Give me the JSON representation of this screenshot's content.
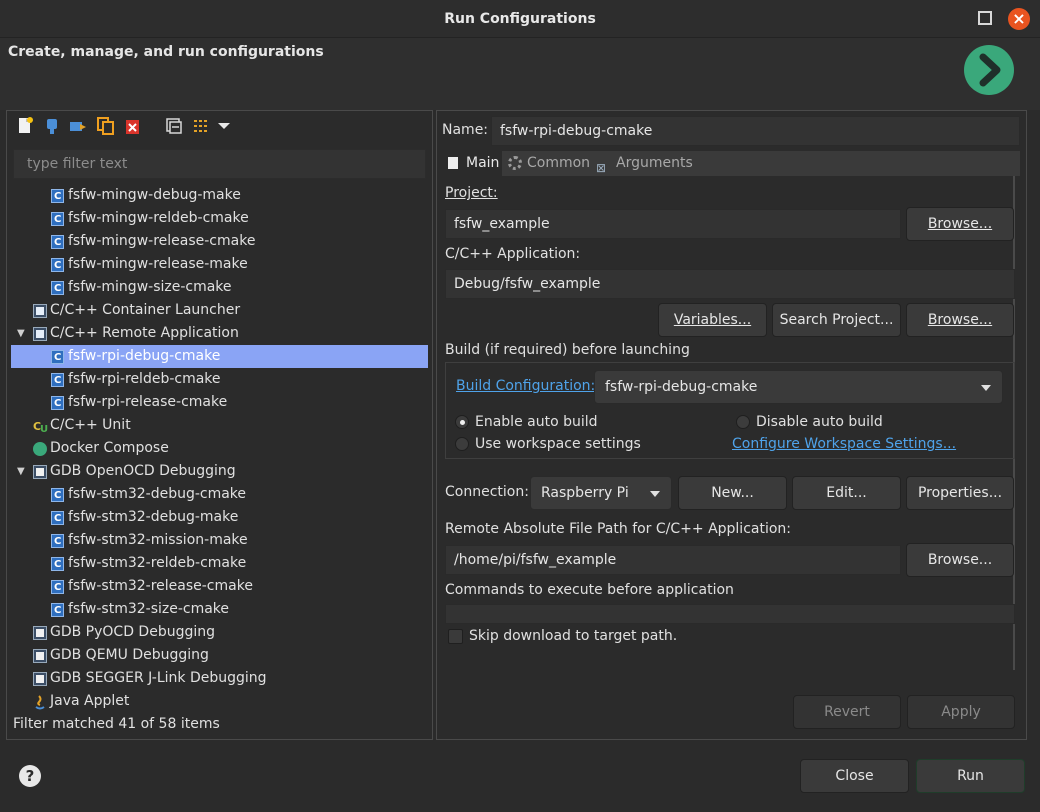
{
  "window": {
    "title": "Run Configurations",
    "header_title": "Create, manage, and run configurations"
  },
  "colors": {
    "accent_run": "#3aa87b",
    "selection": "#8aa4f5",
    "link": "#4fa3ea",
    "close_button": "#e95420"
  },
  "toolbar": {
    "icons": [
      "new-launch-config-icon",
      "new-prototype-icon",
      "export-icon",
      "duplicate-icon",
      "delete-icon",
      "collapse-all-icon",
      "filter-icon",
      "view-menu-chevron-icon"
    ]
  },
  "filter": {
    "placeholder": "type filter text",
    "status": "Filter matched 41 of 58 items"
  },
  "tree": {
    "items": [
      {
        "label": "fsfw-mingw-debug-make",
        "level": 2,
        "icon": "c-config-icon"
      },
      {
        "label": "fsfw-mingw-reldeb-cmake",
        "level": 2,
        "icon": "c-config-icon"
      },
      {
        "label": "fsfw-mingw-release-cmake",
        "level": 2,
        "icon": "c-config-icon"
      },
      {
        "label": "fsfw-mingw-release-make",
        "level": 2,
        "icon": "c-config-icon"
      },
      {
        "label": "fsfw-mingw-size-cmake",
        "level": 2,
        "icon": "c-config-icon"
      },
      {
        "label": "C/C++ Container Launcher",
        "level": 1,
        "icon": "container-launcher-icon"
      },
      {
        "label": "C/C++ Remote Application",
        "level": 1,
        "icon": "remote-app-icon",
        "expanded": true
      },
      {
        "label": "fsfw-rpi-debug-cmake",
        "level": 2,
        "icon": "c-config-icon",
        "selected": true
      },
      {
        "label": "fsfw-rpi-reldeb-cmake",
        "level": 2,
        "icon": "c-config-icon"
      },
      {
        "label": "fsfw-rpi-release-cmake",
        "level": 2,
        "icon": "c-config-icon"
      },
      {
        "label": "C/C++ Unit",
        "level": 1,
        "icon": "cpp-unit-icon"
      },
      {
        "label": "Docker Compose",
        "level": 1,
        "icon": "docker-compose-icon"
      },
      {
        "label": "GDB OpenOCD Debugging",
        "level": 1,
        "icon": "gdb-openocd-icon",
        "expanded": true
      },
      {
        "label": "fsfw-stm32-debug-cmake",
        "level": 2,
        "icon": "c-config-icon"
      },
      {
        "label": "fsfw-stm32-debug-make",
        "level": 2,
        "icon": "c-config-icon"
      },
      {
        "label": "fsfw-stm32-mission-make",
        "level": 2,
        "icon": "c-config-icon"
      },
      {
        "label": "fsfw-stm32-reldeb-cmake",
        "level": 2,
        "icon": "c-config-icon"
      },
      {
        "label": "fsfw-stm32-release-cmake",
        "level": 2,
        "icon": "c-config-icon"
      },
      {
        "label": "fsfw-stm32-size-cmake",
        "level": 2,
        "icon": "c-config-icon"
      },
      {
        "label": "GDB PyOCD Debugging",
        "level": 1,
        "icon": "gdb-pyocd-icon"
      },
      {
        "label": "GDB QEMU Debugging",
        "level": 1,
        "icon": "gdb-qemu-icon"
      },
      {
        "label": "GDB SEGGER J-Link Debugging",
        "level": 1,
        "icon": "gdb-jlink-icon"
      },
      {
        "label": "Java Applet",
        "level": 1,
        "icon": "java-applet-icon"
      }
    ]
  },
  "editor": {
    "name_label": "Name:",
    "name_value": "fsfw-rpi-debug-cmake",
    "tabs": [
      {
        "label": "Main",
        "icon": "main-tab-icon",
        "active": true
      },
      {
        "label": "Common",
        "icon": "common-tab-icon",
        "active": false
      },
      {
        "label": "Arguments",
        "icon": "arguments-tab-icon",
        "active": false
      }
    ],
    "project_label": "Project:",
    "project_value": "fsfw_example",
    "browse_label": "Browse...",
    "app_label": "C/C++ Application:",
    "app_value": "Debug/fsfw_example",
    "variables_label": "Variables...",
    "search_project_label": "Search Project...",
    "build_group_label": "Build (if required) before launching",
    "build_config_link": "Build Configuration:",
    "build_config_value": "fsfw-rpi-debug-cmake",
    "enable_auto_build": "Enable auto build",
    "disable_auto_build": "Disable auto build",
    "use_workspace_settings": "Use workspace settings",
    "configure_workspace_link": "Configure Workspace Settings...",
    "connection_label": "Connection:",
    "connection_value": "Raspberry Pi",
    "new_label": "New...",
    "edit_label": "Edit...",
    "properties_label": "Properties...",
    "remote_path_label": "Remote Absolute File Path for C/C++ Application:",
    "remote_path_value": "/home/pi/fsfw_example",
    "commands_label": "Commands to execute before application",
    "commands_value": "",
    "skip_download_label": "Skip download to target path.",
    "revert_label": "Revert",
    "apply_label": "Apply"
  },
  "footer": {
    "close_label": "Close",
    "run_label": "Run"
  }
}
